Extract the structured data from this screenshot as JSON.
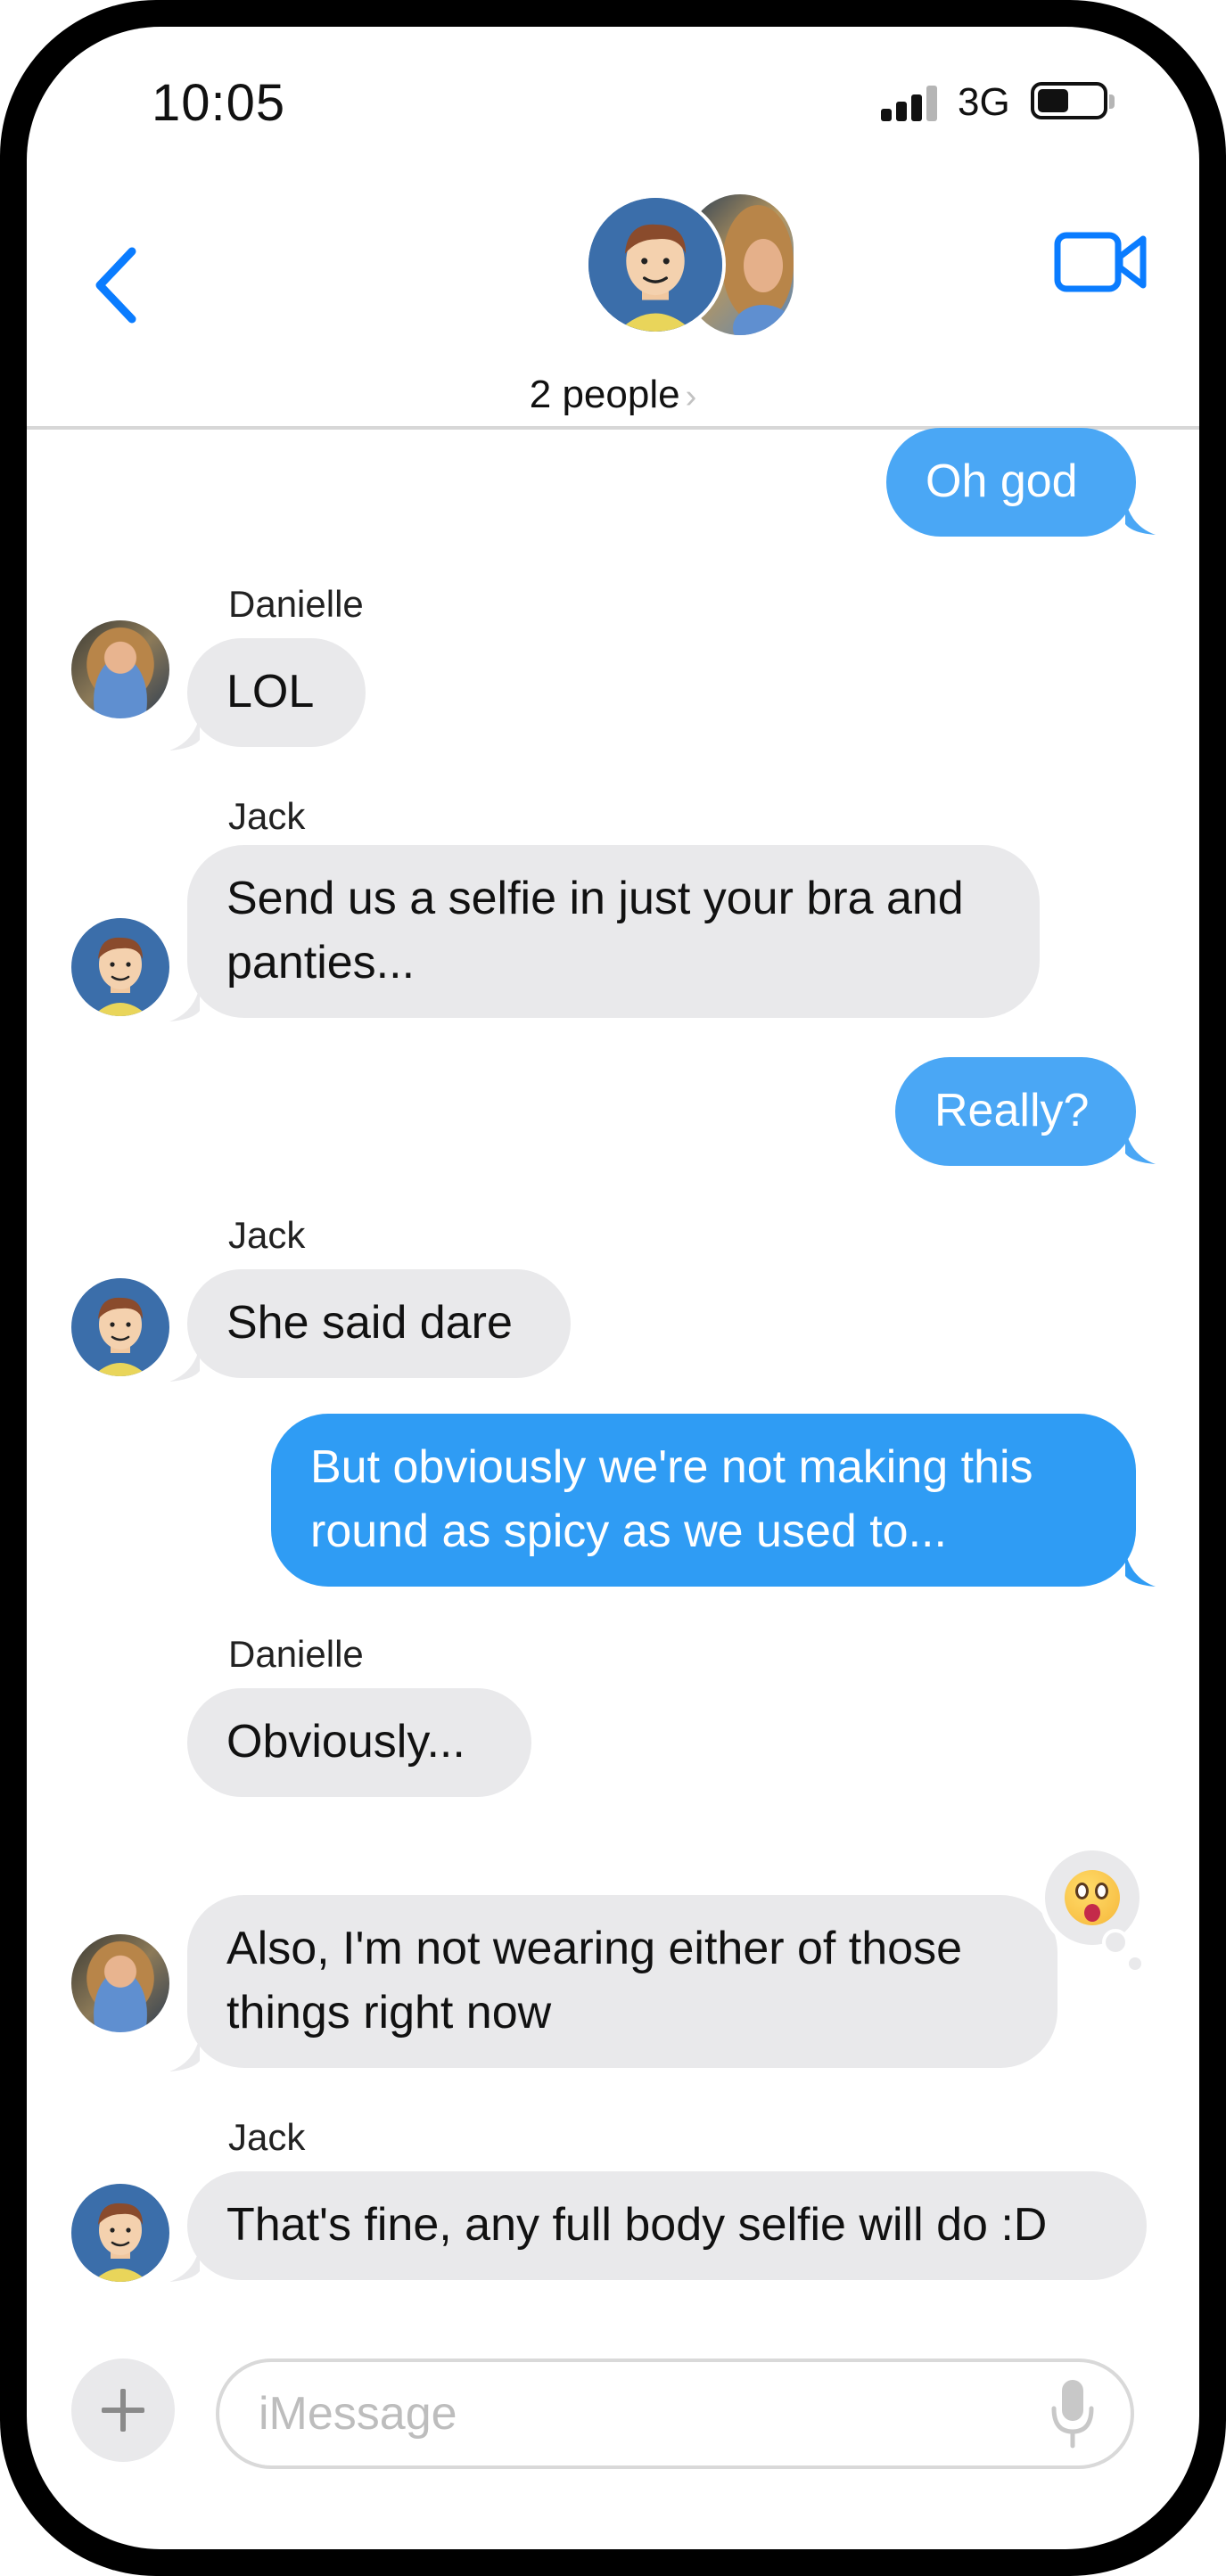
{
  "status_bar": {
    "time": "10:05",
    "network": "3G",
    "signal_bars_active": 3,
    "battery_level": 0.45
  },
  "header": {
    "title": "2 people",
    "chevron": "›",
    "back_icon": "chevron-left-icon",
    "video_icon": "video-camera-icon"
  },
  "messages": [
    {
      "sender": "",
      "direction": "outgoing",
      "text": "Oh god"
    },
    {
      "sender": "Danielle",
      "direction": "incoming",
      "text": "LOL"
    },
    {
      "sender": "Jack",
      "direction": "incoming",
      "text_lines": [
        "Send us a selfie in just your bra and",
        "panties..."
      ]
    },
    {
      "sender": "",
      "direction": "outgoing",
      "text": "Really?"
    },
    {
      "sender": "Jack",
      "direction": "incoming",
      "text": "She said dare"
    },
    {
      "sender": "",
      "direction": "outgoing",
      "text_lines": [
        "But obviously we're not making this",
        "round as spicy as we used to..."
      ]
    },
    {
      "sender": "Danielle",
      "direction": "incoming",
      "text": "Obviously..."
    },
    {
      "sender": "",
      "direction": "incoming",
      "text_lines": [
        "Also, I'm not wearing either of those",
        "things right now"
      ],
      "reaction": "astonished-face-emoji"
    },
    {
      "sender": "Jack",
      "direction": "incoming",
      "text": "That's fine, any full body selfie will do :D"
    }
  ],
  "composer": {
    "placeholder": "iMessage",
    "value": "",
    "plus_icon": "plus-icon",
    "mic_icon": "microphone-icon"
  },
  "colors": {
    "outgoing_bubble": "#2f9cf4",
    "incoming_bubble": "#e9e9eb",
    "accent": "#0a7cff"
  }
}
